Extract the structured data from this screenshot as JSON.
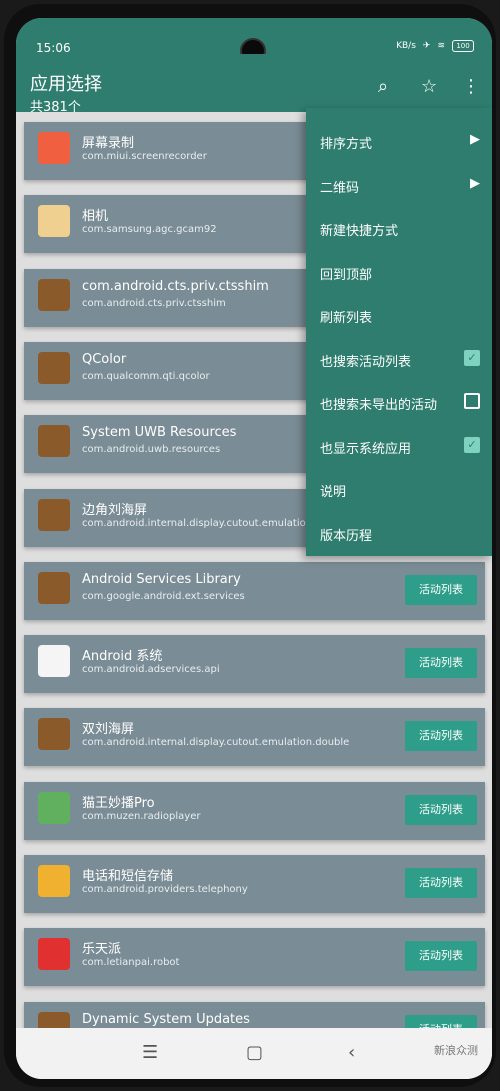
{
  "status": {
    "time": "15:06",
    "speed": "KB/s",
    "battery": "100"
  },
  "appbar": {
    "title": "应用选择",
    "count": "共381个",
    "search_icon": "search-icon",
    "star_icon": "star-icon",
    "more_icon": "more-vert-icon"
  },
  "apps": [
    {
      "name": "屏幕录制",
      "pkg": "com.miui.screenrecorder",
      "icon_color": "#f06040"
    },
    {
      "name": "相机",
      "pkg": "com.samsung.agc.gcam92",
      "icon_color": "#f0d090"
    },
    {
      "name": "com.android.cts.priv.ctsshim",
      "pkg": "com.android.cts.priv.ctsshim",
      "icon_color": "#8a5a2a"
    },
    {
      "name": "QColor",
      "pkg": "com.qualcomm.qti.qcolor",
      "icon_color": "#8a5a2a"
    },
    {
      "name": "System UWB Resources",
      "pkg": "com.android.uwb.resources",
      "icon_color": "#8a5a2a"
    },
    {
      "name": "边角刘海屏",
      "pkg": "com.android.internal.display.cutout.emulation.corner",
      "icon_color": "#8a5a2a"
    },
    {
      "name": "Android Services Library",
      "pkg": "com.google.android.ext.services",
      "icon_color": "#8a5a2a",
      "button": "活动列表"
    },
    {
      "name": "Android 系统",
      "pkg": "com.android.adservices.api",
      "icon_color": "#f5f5f5",
      "button": "活动列表"
    },
    {
      "name": "双刘海屏",
      "pkg": "com.android.internal.display.cutout.emulation.double",
      "icon_color": "#8a5a2a",
      "button": "活动列表"
    },
    {
      "name": "猫王妙播Pro",
      "pkg": "com.muzen.radioplayer",
      "icon_color": "#60b060",
      "button": "活动列表"
    },
    {
      "name": "电话和短信存储",
      "pkg": "com.android.providers.telephony",
      "icon_color": "#f0b030",
      "button": "活动列表"
    },
    {
      "name": "乐天派",
      "pkg": "com.letianpai.robot",
      "icon_color": "#e03030",
      "button": "活动列表"
    },
    {
      "name": "Dynamic System Updates",
      "pkg": "",
      "icon_color": "#8a5a2a",
      "button": "活动列表"
    }
  ],
  "menu": [
    {
      "label": "排序方式",
      "type": "submenu"
    },
    {
      "label": "二维码",
      "type": "submenu"
    },
    {
      "label": "新建快捷方式",
      "type": "plain"
    },
    {
      "label": "回到顶部",
      "type": "plain"
    },
    {
      "label": "刷新列表",
      "type": "plain"
    },
    {
      "label": "也搜索活动列表",
      "type": "checkbox",
      "checked": true
    },
    {
      "label": "也搜索未导出的活动",
      "type": "checkbox",
      "checked": false
    },
    {
      "label": "也显示系统应用",
      "type": "checkbox",
      "checked": true
    },
    {
      "label": "说明",
      "type": "plain"
    },
    {
      "label": "版本历程",
      "type": "plain"
    }
  ],
  "navbar": {
    "menu_icon": "menu-icon",
    "home_icon": "home-icon",
    "back_icon": "back-icon"
  },
  "watermark": "新浪众测"
}
